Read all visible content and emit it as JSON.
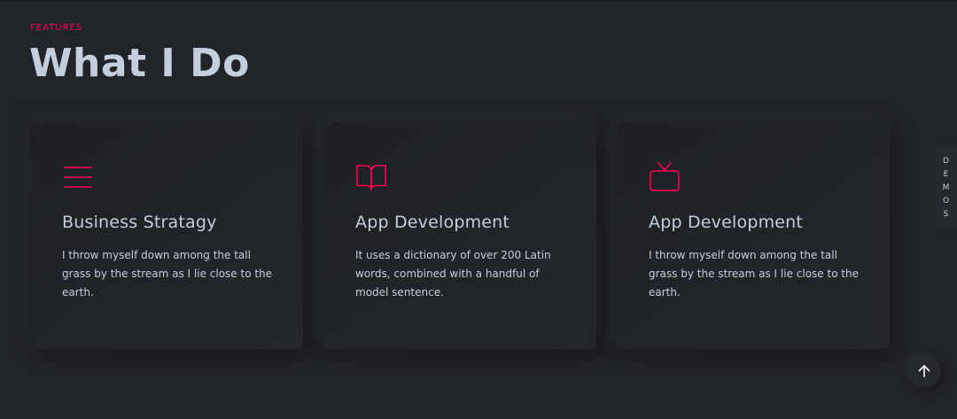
{
  "section": {
    "eyebrow": "FEATURES",
    "title": "What I Do"
  },
  "cards": [
    {
      "icon": "menu-lines-icon",
      "title": "Business Stratagy",
      "text": "I throw myself down among the tall grass by the stream as I lie close to the earth."
    },
    {
      "icon": "book-open-icon",
      "title": "App Development",
      "text": "It uses a dictionary of over 200 Latin words, combined with a handful of model sentence."
    },
    {
      "icon": "tv-icon",
      "title": "App Development",
      "text": "I throw myself down among the tall grass by the stream as I lie close to the earth."
    }
  ],
  "demos_tab": {
    "letters": [
      "D",
      "E",
      "M",
      "O",
      "S"
    ]
  },
  "scroll_top": {
    "icon": "arrow-up-icon"
  },
  "colors": {
    "accent": "#ff014f",
    "background": "#212428",
    "text": "#c4cfde"
  }
}
